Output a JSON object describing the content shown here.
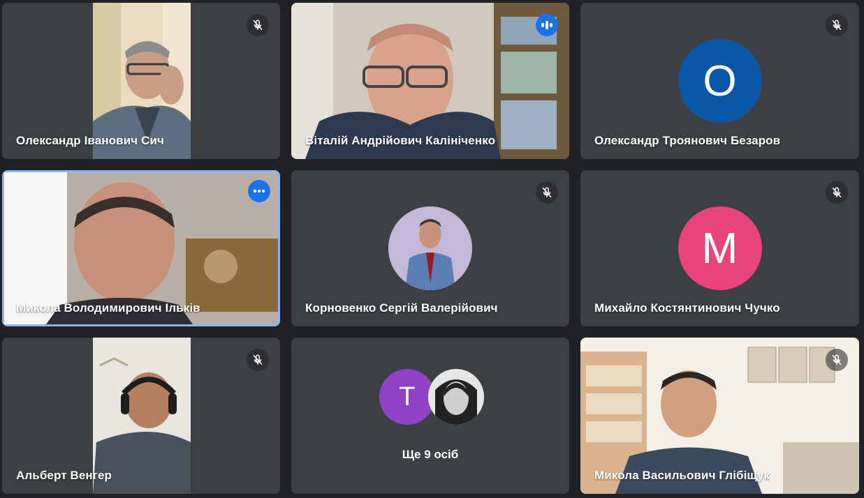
{
  "participants": [
    {
      "name": "Олександр Іванович Сич",
      "mic": "muted"
    },
    {
      "name": "Віталій Андрійович Калініченко",
      "mic": "speaking"
    },
    {
      "name": "Олександр Троянович Безаров",
      "mic": "muted",
      "avatar_letter": "O",
      "avatar_color": "#0b57a7"
    },
    {
      "name": "Микола Володимирович Ільків",
      "mic": "options"
    },
    {
      "name": "Корновенко Сергій Валерійович",
      "mic": "muted"
    },
    {
      "name": "Михайло Костянтинович Чучко",
      "mic": "muted",
      "avatar_letter": "M",
      "avatar_color": "#e8437a"
    },
    {
      "name": "Альберт Венгер",
      "mic": "muted"
    },
    {
      "name": "Микола Васильович Глібіщук",
      "mic": "muted"
    }
  ],
  "others": {
    "label": "Ще 9 осіб",
    "avatar_letter": "T",
    "avatar_color": "#8e44c4"
  },
  "colors": {
    "background": "#202124",
    "tile": "#3c4043",
    "accent": "#1a73e8",
    "active_border": "#8ab4f8"
  },
  "icons": {
    "muted": "mic-off-icon",
    "speaking": "audio-level-icon",
    "options": "more-options-icon"
  }
}
